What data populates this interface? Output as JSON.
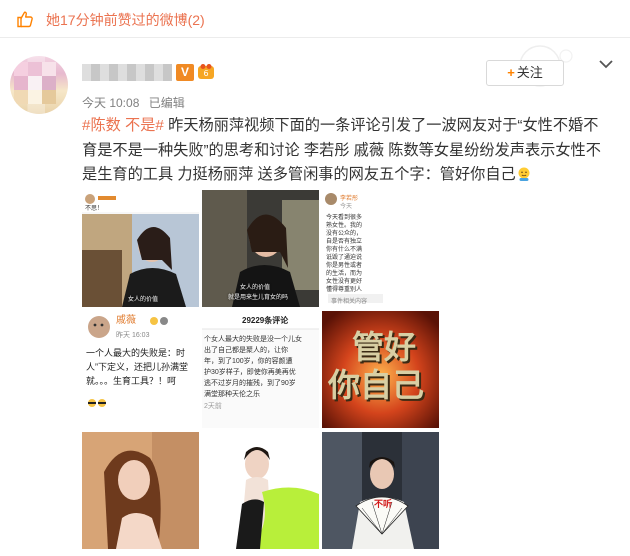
{
  "topbar": {
    "text": "她17分钟前赞过的微博(2)",
    "icon": "thumbs-up-icon"
  },
  "post": {
    "verified_badge": "V",
    "time": "今天 10:08",
    "edited": "已编辑",
    "follow_label": "关注",
    "hashtag": "#陈数 不是#",
    "body": " 昨天杨丽萍视频下面的一条评论引发了一波网友对于“女性不婚不育是不是一种失败”的思考和讨论 李若彤 戚薇 陈数等女星纷纷发声表示女性不是生育的工具 力挺杨丽萍 送多管闲事的网友五个字：管好你自己"
  },
  "images": {
    "img1": {
      "top_label": "不思！",
      "subtitle": "女人的价值"
    },
    "img2": {
      "caption_1": "女人的价值",
      "caption_2": "就是用来生儿育女的吗"
    },
    "img3": {
      "name": "李若彤",
      "date": "今天",
      "lines": [
        "今天看到很多",
        "熟女性。我的",
        "没有公众的，",
        "自是否有独立",
        "你有什么不满",
        "诋毁了通迫说",
        "你是男性或者",
        "的生活，而为",
        "女性没有更好",
        "懂得尊重别人"
      ],
      "footer": "事件相关内容"
    },
    "img4": {
      "name": "戚薇",
      "date": "昨天 16:03",
      "lines": [
        "一个人最大的失败是：时",
        "人”下定义，还把儿孙满堂",
        "就。。。生育工具？！呵"
      ]
    },
    "img5": {
      "header": "29229条评论",
      "lines": [
        "个女人最大的失败是没一个儿女",
        "出了自己都是聚人的，让你",
        "年，到了100岁，你的容颜遭",
        "护30岁样子，即使你再美再优",
        "逃不过岁月的摧残，到了90岁",
        "满堂那种天伦之乐"
      ],
      "footer": "2天前"
    },
    "img6": {
      "line1": "管好",
      "line2": "你自己"
    },
    "img9": {
      "fan_text": "不听"
    }
  },
  "colors": {
    "accent": "#eb7350",
    "follow_plus": "#ff8200",
    "meta": "#808080",
    "text": "#333333"
  }
}
